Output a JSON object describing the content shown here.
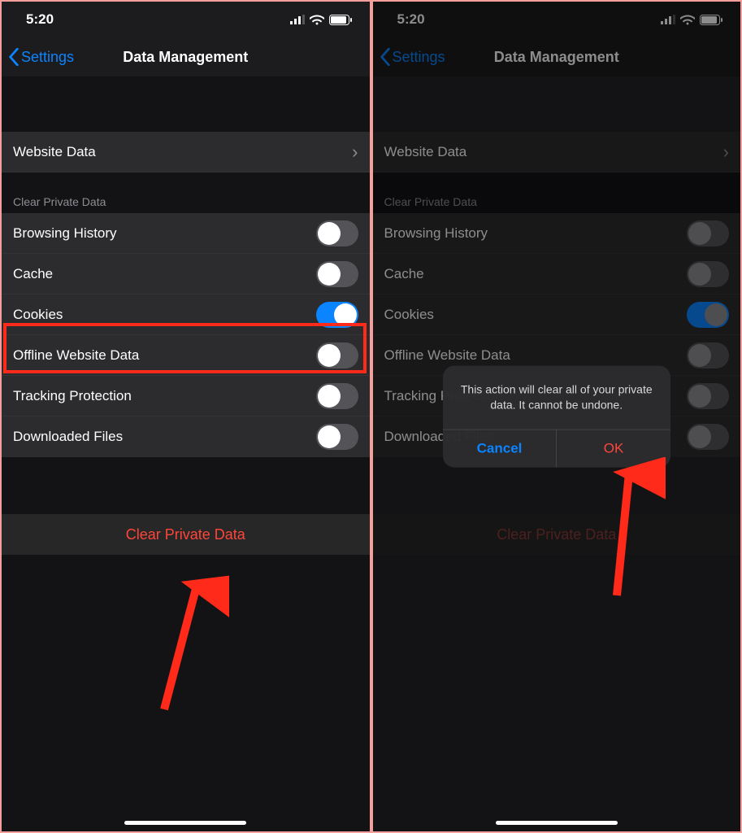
{
  "status": {
    "time": "5:20"
  },
  "nav": {
    "back": "Settings",
    "title": "Data Management"
  },
  "website_data": {
    "label": "Website Data"
  },
  "section_header": "Clear Private Data",
  "toggles": [
    {
      "label": "Browsing History",
      "on": false
    },
    {
      "label": "Cache",
      "on": false
    },
    {
      "label": "Cookies",
      "on": true
    },
    {
      "label": "Offline Website Data",
      "on": false
    },
    {
      "label": "Tracking Protection",
      "on": false
    },
    {
      "label": "Downloaded Files",
      "on": false
    }
  ],
  "clear_button": "Clear Private Data",
  "alert": {
    "message": "This action will clear all of your private data. It cannot be undone.",
    "cancel": "Cancel",
    "ok": "OK"
  }
}
